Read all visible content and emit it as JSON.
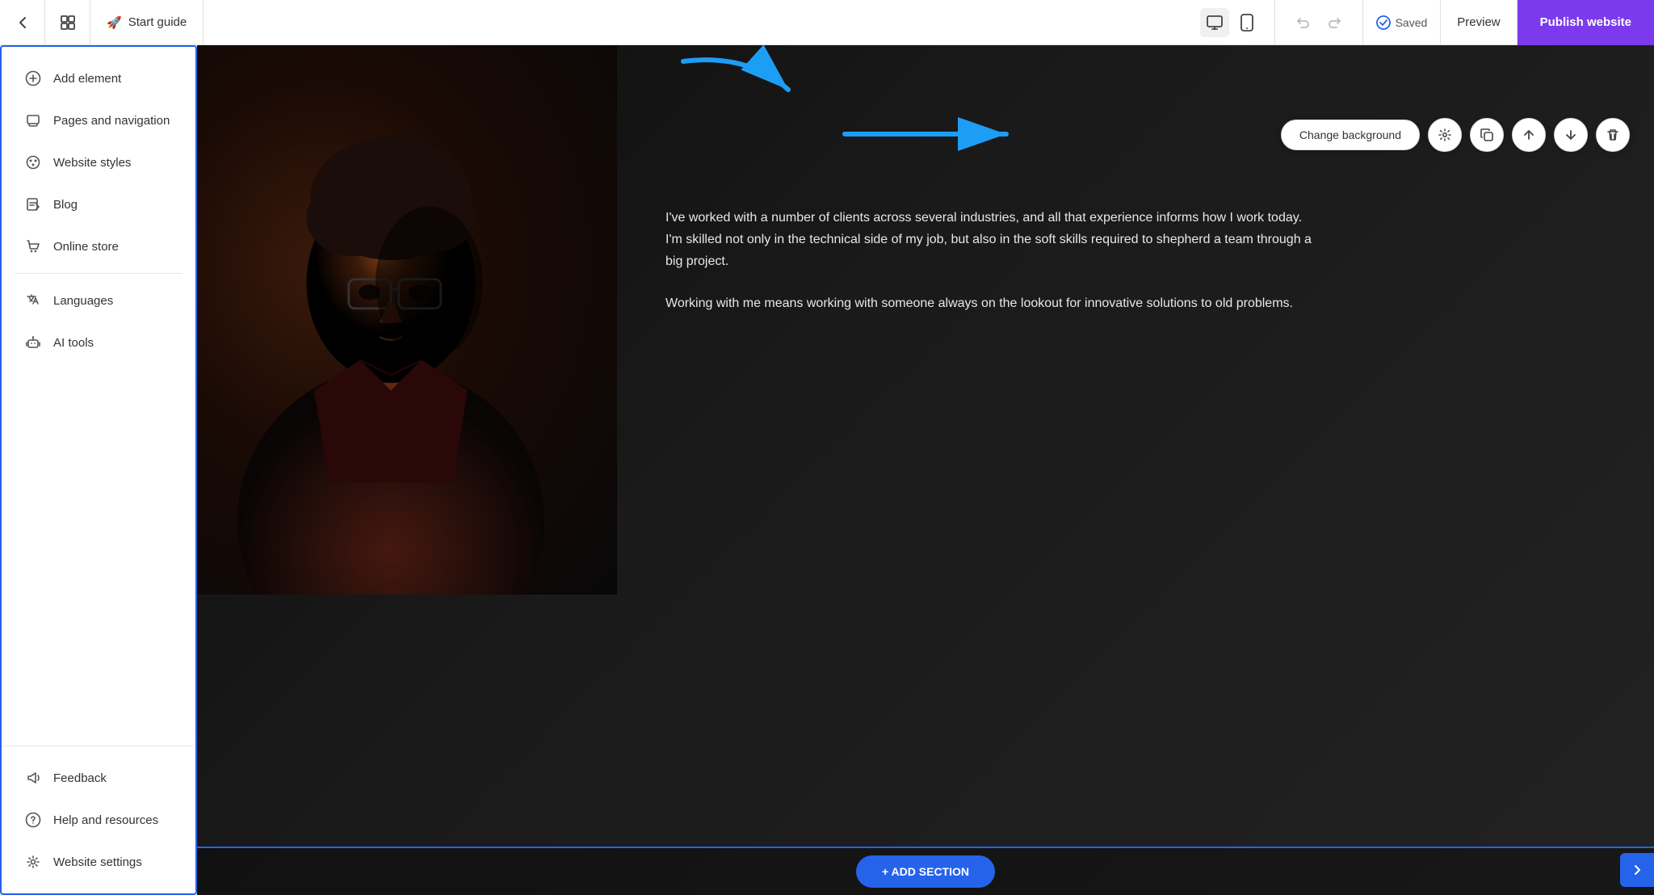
{
  "topbar": {
    "back_label": "←",
    "show_pages_icon": "pages-icon",
    "start_guide_label": "Start guide",
    "rocket_icon": "rocket-icon",
    "desktop_icon": "desktop-icon",
    "mobile_icon": "mobile-icon",
    "undo_icon": "undo-icon",
    "redo_icon": "redo-icon",
    "saved_label": "Saved",
    "saved_icon": "check-circle-icon",
    "preview_label": "Preview",
    "publish_label": "Publish website"
  },
  "sidebar": {
    "items": [
      {
        "id": "add-element",
        "label": "Add element",
        "icon": "plus-circle-icon"
      },
      {
        "id": "pages-navigation",
        "label": "Pages and navigation",
        "icon": "layers-icon"
      },
      {
        "id": "website-styles",
        "label": "Website styles",
        "icon": "palette-icon"
      },
      {
        "id": "blog",
        "label": "Blog",
        "icon": "edit-icon"
      },
      {
        "id": "online-store",
        "label": "Online store",
        "icon": "cart-icon"
      },
      {
        "id": "languages",
        "label": "Languages",
        "icon": "translate-icon"
      },
      {
        "id": "ai-tools",
        "label": "AI tools",
        "icon": "robot-icon"
      }
    ],
    "bottom_items": [
      {
        "id": "feedback",
        "label": "Feedback",
        "icon": "megaphone-icon"
      },
      {
        "id": "help-resources",
        "label": "Help and resources",
        "icon": "question-circle-icon"
      },
      {
        "id": "website-settings",
        "label": "Website settings",
        "icon": "gear-icon"
      }
    ]
  },
  "canvas": {
    "section_toolbar": {
      "change_bg_label": "Change background",
      "settings_icon": "settings-icon",
      "copy_icon": "copy-icon",
      "move_up_icon": "arrow-up-icon",
      "move_down_icon": "arrow-down-icon",
      "delete_icon": "trash-icon"
    },
    "content": {
      "paragraph1": "I've worked with a number of clients across several industries, and all that experience informs how I work today. I'm skilled not only in the technical side of my job, but also in the soft skills required to shepherd a team through a big project.",
      "paragraph2": "Working with me means working with someone always on the lookout for innovative solutions to old problems."
    },
    "add_section_label": "+ ADD SECTION"
  }
}
